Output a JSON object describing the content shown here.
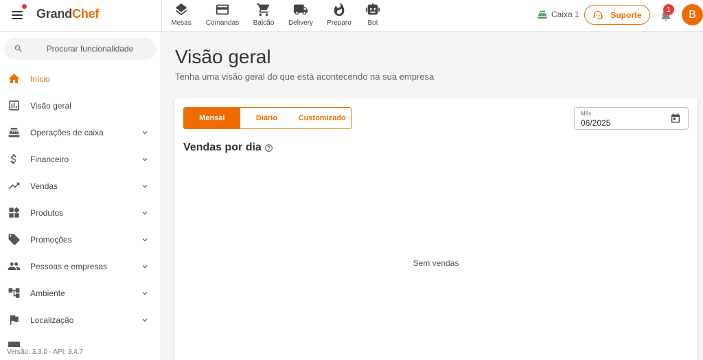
{
  "brand": {
    "part1": "Grand",
    "part2": "Chef"
  },
  "topnav": [
    {
      "label": "Mesas",
      "icon": "layers-icon"
    },
    {
      "label": "Comandas",
      "icon": "card-icon"
    },
    {
      "label": "Balcão",
      "icon": "cart-icon"
    },
    {
      "label": "Delivery",
      "icon": "truck-icon"
    },
    {
      "label": "Preparo",
      "icon": "flame-icon"
    },
    {
      "label": "Bot",
      "icon": "robot-icon"
    }
  ],
  "header": {
    "caixa": "Caixa 1",
    "suporte": "Suporte",
    "notifications": "1",
    "avatar": "B"
  },
  "sidebar": {
    "search_placeholder": "Procurar funcionalidade",
    "items": [
      {
        "label": "Início",
        "icon": "home-icon",
        "active": true,
        "expandable": false
      },
      {
        "label": "Visão geral",
        "icon": "chart-box-icon",
        "active": false,
        "expandable": false
      },
      {
        "label": "Operações de caixa",
        "icon": "cash-register-icon",
        "active": false,
        "expandable": true
      },
      {
        "label": "Financeiro",
        "icon": "dollar-icon",
        "active": false,
        "expandable": true
      },
      {
        "label": "Vendas",
        "icon": "trending-up-icon",
        "active": false,
        "expandable": true
      },
      {
        "label": "Produtos",
        "icon": "widgets-icon",
        "active": false,
        "expandable": true
      },
      {
        "label": "Promoções",
        "icon": "tag-icon",
        "active": false,
        "expandable": true
      },
      {
        "label": "Pessoas e empresas",
        "icon": "people-icon",
        "active": false,
        "expandable": true
      },
      {
        "label": "Ambiente",
        "icon": "account-tree-icon",
        "active": false,
        "expandable": true
      },
      {
        "label": "Localização",
        "icon": "flag-icon",
        "active": false,
        "expandable": true
      }
    ],
    "version": "Versão: 3.3.0 - API: 3.4.7"
  },
  "main": {
    "title": "Visão geral",
    "subtitle": "Tenha uma visão geral do que está acontecendo na sua empresa",
    "tabs": [
      "Mensal",
      "Diário",
      "Customizado"
    ],
    "active_tab": "Mensal",
    "month_label": "Mês",
    "month_value": "06/2025",
    "section_title": "Vendas por dia",
    "empty_text": "Sem vendas"
  },
  "colors": {
    "accent": "#ef6c00",
    "badge": "#e53935",
    "caixa": "#43a047"
  }
}
